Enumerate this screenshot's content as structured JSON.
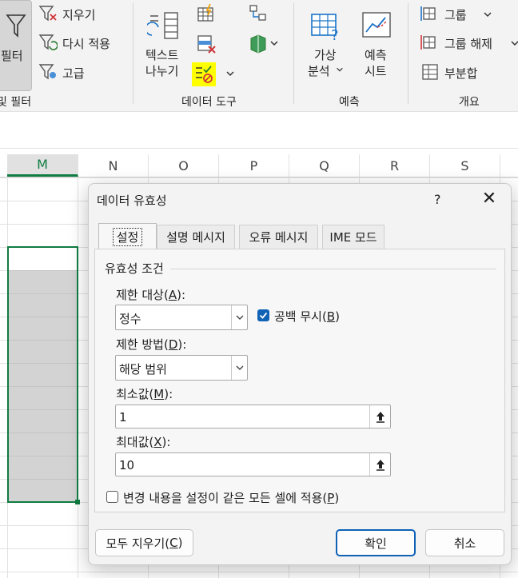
{
  "ribbon": {
    "filter_label": "필터",
    "clear_label": "지우기",
    "reapply_label": "다시 적용",
    "advanced_label": "고급",
    "sort_filter_group": "및 필터",
    "text_to_columns_line1": "텍스트",
    "text_to_columns_line2": "나누기",
    "data_tools_group": "데이터 도구",
    "whatif_line1": "가상",
    "whatif_line2": "분석",
    "forecast_line1": "예측",
    "forecast_line2": "시트",
    "forecast_group": "예측",
    "group_label": "그룹",
    "ungroup_label": "그룹 해제",
    "subtotal_label": "부분합",
    "outline_group": "개요"
  },
  "grid": {
    "columns": [
      "M",
      "N",
      "O",
      "P",
      "Q",
      "R",
      "S"
    ],
    "selected_column": "M"
  },
  "dialog": {
    "title": "데이터 유효성",
    "help": "?",
    "close": "✕",
    "tabs": [
      "설정",
      "설명 메시지",
      "오류 메시지",
      "IME 모드"
    ],
    "active_tab": "설정",
    "section_title": "유효성 조건",
    "allow_label": "제한 대상(",
    "allow_key": "A",
    "allow_value": "정수",
    "ignore_blank_label": "공백 무시(",
    "ignore_blank_key": "B",
    "ignore_blank_checked": true,
    "data_label": "제한 방법(",
    "data_key": "D",
    "data_value": "해당 범위",
    "min_label": "최소값(",
    "min_key": "M",
    "min_value": "1",
    "max_label": "최대값(",
    "max_key": "X",
    "max_value": "10",
    "apply_all_label": "변경 내용을 설정이 같은 모든 셀에 적용(",
    "apply_all_key": "P",
    "apply_all_checked": false,
    "clear_all_label": "모두 지우기(",
    "clear_all_key": "C",
    "ok_label": "확인",
    "cancel_label": "취소",
    "close_paren": ")",
    "colon": ":"
  },
  "colors": {
    "accent": "#0f62b5",
    "excel_green": "#107c41",
    "highlight_yellow": "#ffff00"
  }
}
